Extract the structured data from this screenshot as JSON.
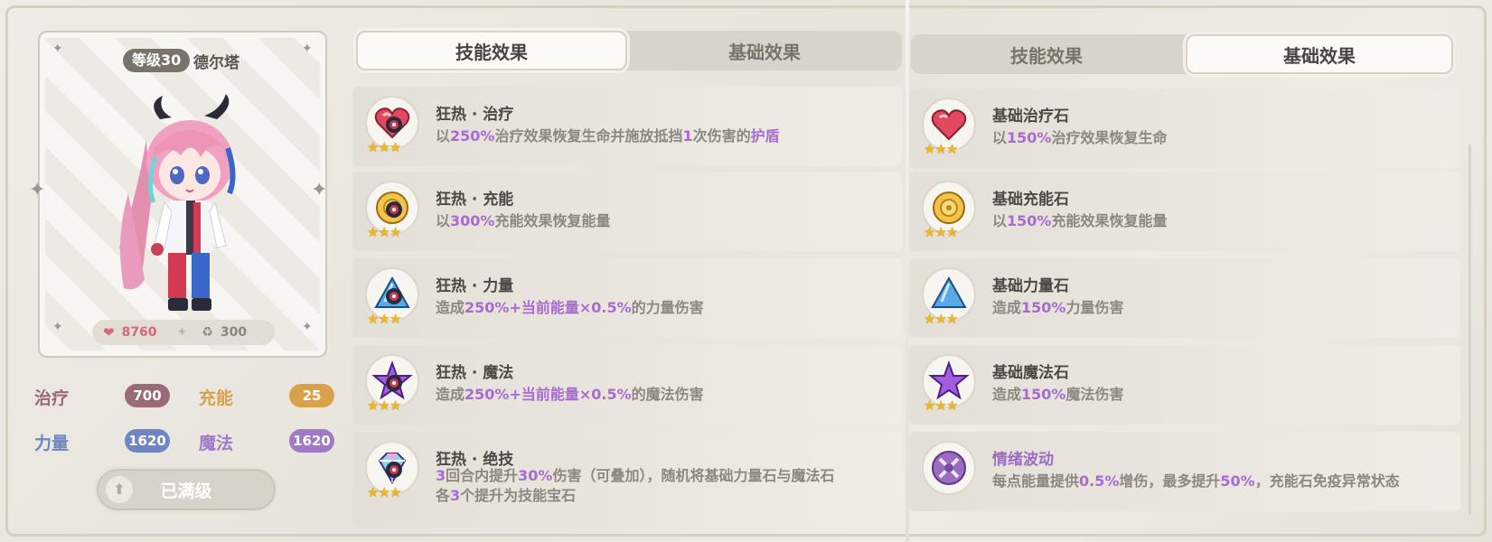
{
  "character": {
    "level_badge": "等级30",
    "name": "德尔塔",
    "hp": "8760",
    "energy": "300",
    "stats": {
      "heal_label": "治疗",
      "heal_value": "700",
      "charge_label": "充能",
      "charge_value": "25",
      "power_label": "力量",
      "power_value": "1620",
      "magic_label": "魔法",
      "magic_value": "1620"
    },
    "maxed_label": "已满级"
  },
  "left_panel": {
    "tabs": [
      {
        "label": "技能效果",
        "active": true
      },
      {
        "label": "基础效果",
        "active": false
      }
    ],
    "skills": [
      {
        "title": "狂热 · 治疗",
        "icon": "heart-gem-icon",
        "desc_parts": [
          "以",
          "250%",
          "治疗效果恢复生命并施放抵挡",
          "1",
          "次伤害的",
          "护盾"
        ]
      },
      {
        "title": "狂热 · 充能",
        "icon": "charge-gem-icon",
        "desc_parts": [
          "以",
          "300%",
          "充能效果恢复能量"
        ]
      },
      {
        "title": "狂热 · 力量",
        "icon": "power-gem-icon",
        "desc_parts": [
          "造成",
          "250%+当前能量×0.5%",
          "的力量伤害"
        ]
      },
      {
        "title": "狂热 · 魔法",
        "icon": "magic-star-icon",
        "desc_parts": [
          "造成",
          "250%+当前能量×0.5%",
          "的魔法伤害"
        ]
      },
      {
        "title": "狂热 · 绝技",
        "icon": "diamond-gem-icon",
        "desc_line1_parts": [
          "3",
          "回合内提升",
          "30%",
          "伤害（可叠加），随机将基础力量石与魔法石"
        ],
        "desc_line2_parts": [
          "各",
          "3",
          "个提升为技能宝石"
        ]
      }
    ]
  },
  "right_panel": {
    "tabs": [
      {
        "label": "技能效果",
        "active": false
      },
      {
        "label": "基础效果",
        "active": true
      }
    ],
    "items": [
      {
        "title": "基础治疗石",
        "icon": "heart-gem-icon",
        "desc_parts": [
          "以",
          "150%",
          "治疗效果恢复生命"
        ]
      },
      {
        "title": "基础充能石",
        "icon": "charge-gem-icon",
        "desc_parts": [
          "以",
          "150%",
          "充能效果恢复能量"
        ]
      },
      {
        "title": "基础力量石",
        "icon": "power-gem-icon",
        "desc_parts": [
          "造成",
          "150%",
          "力量伤害"
        ]
      },
      {
        "title": "基础魔法石",
        "icon": "magic-star-icon",
        "desc_parts": [
          "造成",
          "150%",
          "魔法伤害"
        ]
      },
      {
        "title": "情绪波动",
        "icon": "crossed-swords-icon",
        "desc_parts": [
          "每点能量提供",
          "0.5%",
          "增伤，最多提升",
          "50%",
          "，充能石免疫异常状态"
        ]
      }
    ]
  },
  "colors": {
    "accent_purple": "#a86bd0",
    "heal": "#9a6a78",
    "charge": "#d9a24a",
    "power": "#6f86c4",
    "magic": "#a07ac8",
    "star": "#f0b820"
  }
}
